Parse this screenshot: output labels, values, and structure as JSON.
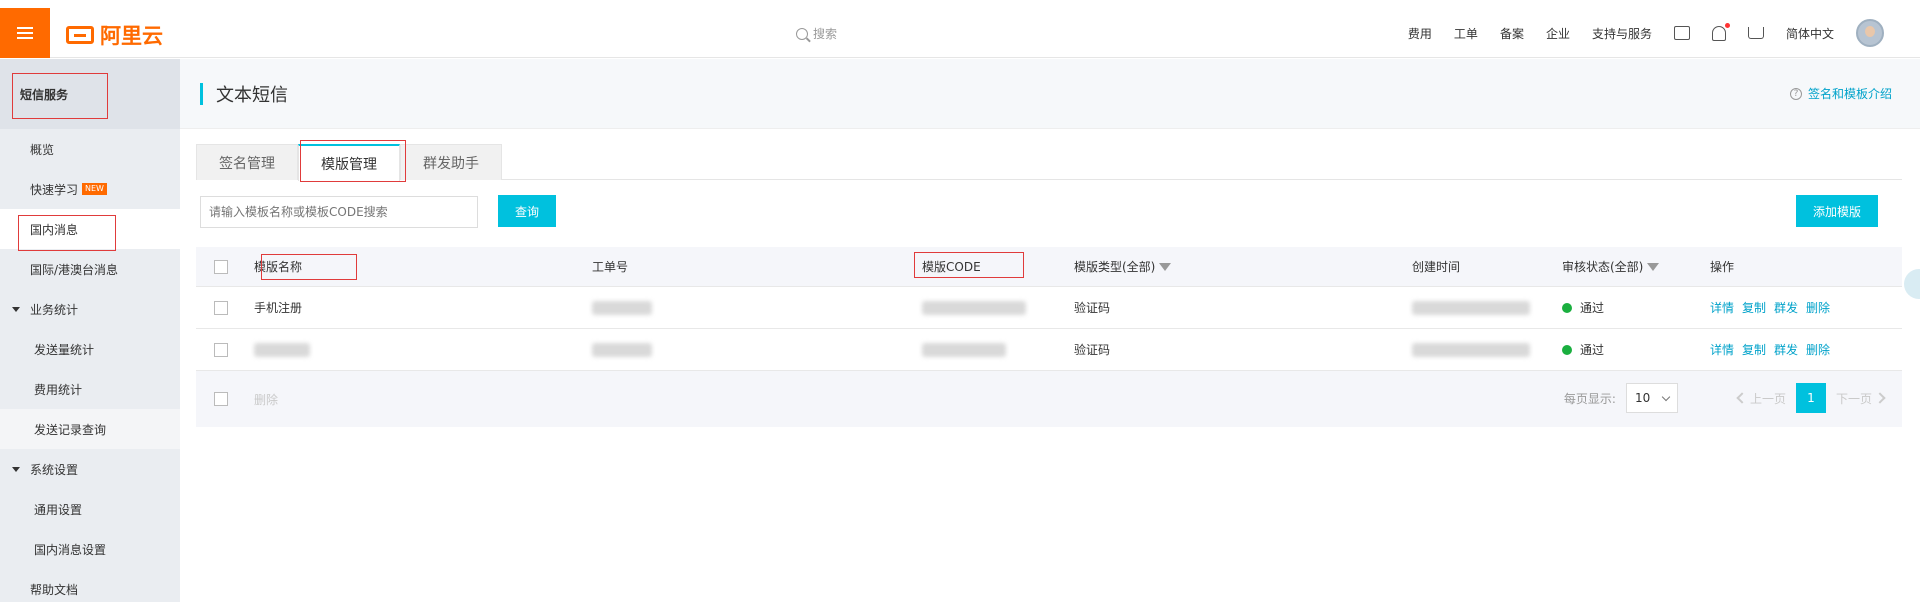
{
  "brand": {
    "logo_text": "阿里云",
    "accent": "#ff6a00"
  },
  "search": {
    "placeholder": "搜索"
  },
  "topnav": [
    "费用",
    "工单",
    "备案",
    "企业",
    "支持与服务"
  ],
  "language": "简体中文",
  "sidebar": {
    "title": "短信服务",
    "items": [
      {
        "label": "概览"
      },
      {
        "label": "快速学习",
        "badge": "NEW"
      },
      {
        "label": "国内消息"
      },
      {
        "label": "国际/港澳台消息"
      }
    ],
    "group_stats": {
      "label": "业务统计",
      "children": [
        "发送量统计",
        "费用统计",
        "发送记录查询"
      ]
    },
    "group_settings": {
      "label": "系统设置",
      "children": [
        "通用设置",
        "国内消息设置"
      ]
    },
    "help": "帮助文档"
  },
  "page": {
    "title": "文本短信",
    "help_link": "签名和模板介绍",
    "tabs": [
      "签名管理",
      "模版管理",
      "群发助手"
    ],
    "search_placeholder": "请输入模板名称或模板CODE搜索",
    "query_label": "查询",
    "add_label": "添加模版"
  },
  "table": {
    "headers": [
      "模版名称",
      "工单号",
      "模版CODE",
      "模版类型(全部)",
      "创建时间",
      "审核状态(全部)",
      "操作"
    ],
    "rows": [
      {
        "name": "手机注册",
        "type": "验证码",
        "status": "通过",
        "status_color": "#1aaf3f"
      },
      {
        "name": "",
        "type": "验证码",
        "status": "通过",
        "status_color": "#1aaf3f"
      }
    ],
    "actions": [
      "详情",
      "复制",
      "群发",
      "删除"
    ],
    "delete_label": "删除"
  },
  "pager": {
    "page_size_label": "每页显示:",
    "page_size": "10",
    "prev": "上一页",
    "current": "1",
    "next": "下一页"
  }
}
